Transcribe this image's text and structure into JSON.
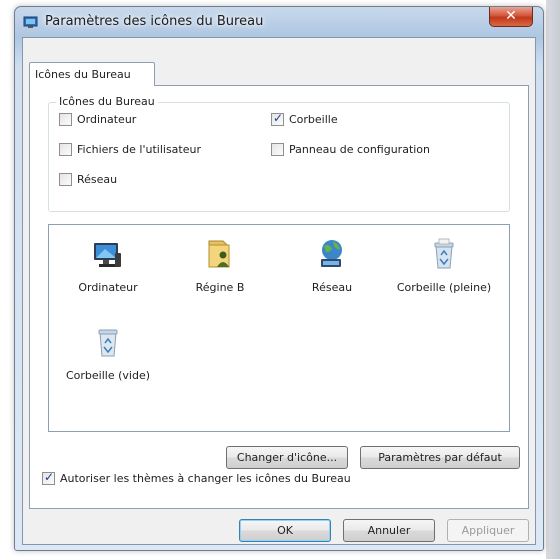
{
  "window": {
    "title": "Paramètres des icônes du Bureau",
    "close_glyph": "✕"
  },
  "tabs": [
    {
      "label": "Icônes du Bureau",
      "selected": true
    }
  ],
  "desktop_icons_group": {
    "title": "Icônes du Bureau",
    "checkboxes": [
      {
        "label": "Ordinateur",
        "checked": false
      },
      {
        "label": "Corbeille",
        "checked": true
      },
      {
        "label": "Fichiers de l'utilisateur",
        "checked": false
      },
      {
        "label": "Panneau de configuration",
        "checked": false
      },
      {
        "label": "Réseau",
        "checked": false
      }
    ]
  },
  "icon_list": [
    {
      "label": "Ordinateur",
      "icon": "computer-icon"
    },
    {
      "label": "Régine B",
      "icon": "user-folder-icon"
    },
    {
      "label": "Réseau",
      "icon": "network-icon"
    },
    {
      "label": "Corbeille (pleine)",
      "icon": "recycle-bin-full-icon"
    },
    {
      "label": "Corbeille (vide)",
      "icon": "recycle-bin-empty-icon"
    }
  ],
  "buttons": {
    "change_icon": "Changer d'icône...",
    "restore_default": "Paramètres par défaut",
    "ok": "OK",
    "cancel": "Annuler",
    "apply": "Appliquer"
  },
  "allow_themes": {
    "label": "Autoriser les thèmes à changer les icônes du Bureau",
    "checked": true
  },
  "colors": {
    "accent_blue": "#1e3a8a",
    "close_red": "#c2371c",
    "window_frame": "#aec6e2"
  }
}
